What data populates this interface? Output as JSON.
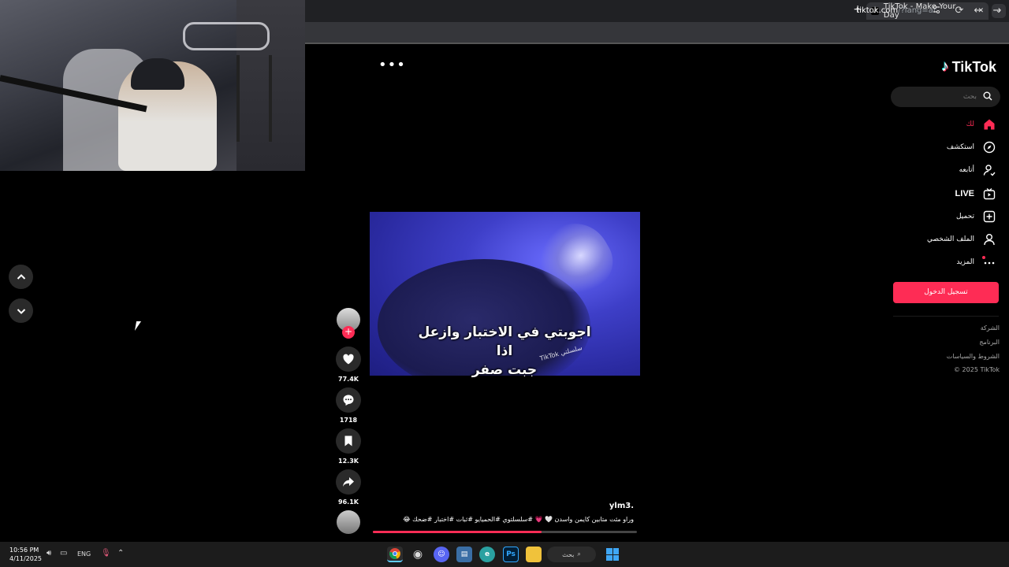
{
  "browser": {
    "tab_title": "TikTok - Make Your Day",
    "tab_close": "✕",
    "new_tab": "+",
    "tab_menu": "⌄",
    "url_host": "tiktok.com",
    "url_path": "/?lang=ar"
  },
  "tiktok": {
    "logo_text": "TikTok",
    "search_placeholder": "بحث",
    "nav": [
      {
        "label": "لك",
        "icon": "home-icon",
        "active": true
      },
      {
        "label": "استكشف",
        "icon": "compass-icon"
      },
      {
        "label": "أتابعه",
        "icon": "following-icon"
      },
      {
        "label": "LIVE",
        "icon": "live-icon"
      },
      {
        "label": "تحميل",
        "icon": "upload-icon"
      },
      {
        "label": "الملف الشخصي",
        "icon": "profile-icon"
      },
      {
        "label": "المزيد",
        "icon": "more-icon"
      }
    ],
    "login_label": "تسجيل الدخول",
    "footer": [
      "الشركة",
      "البرنامج",
      "الشروط والسياسات",
      "© 2025 TikTok"
    ],
    "more_options": "•••",
    "accent_color": "#fe2c55"
  },
  "video": {
    "caption_line1": "اجوبتي في الاختبار وازعل اذا",
    "caption_line2": "جبت صفر",
    "watermark": "TikTok سلسلتي",
    "author": "ylm3.",
    "description": "وراو مثت متابين كايمن واسدن 🤍 💗 #سلسلتوي #الحميايو #ثبات #اختبار #ضحك 😂",
    "progress": 0.64,
    "likes": "77.4K",
    "comments": "1718",
    "saves": "12.3K",
    "shares": "96.1K",
    "follow_symbol": "+"
  },
  "taskbar": {
    "time": "10:56 PM",
    "date": "4/11/2025",
    "language": "ENG",
    "search_label": "بحث"
  }
}
